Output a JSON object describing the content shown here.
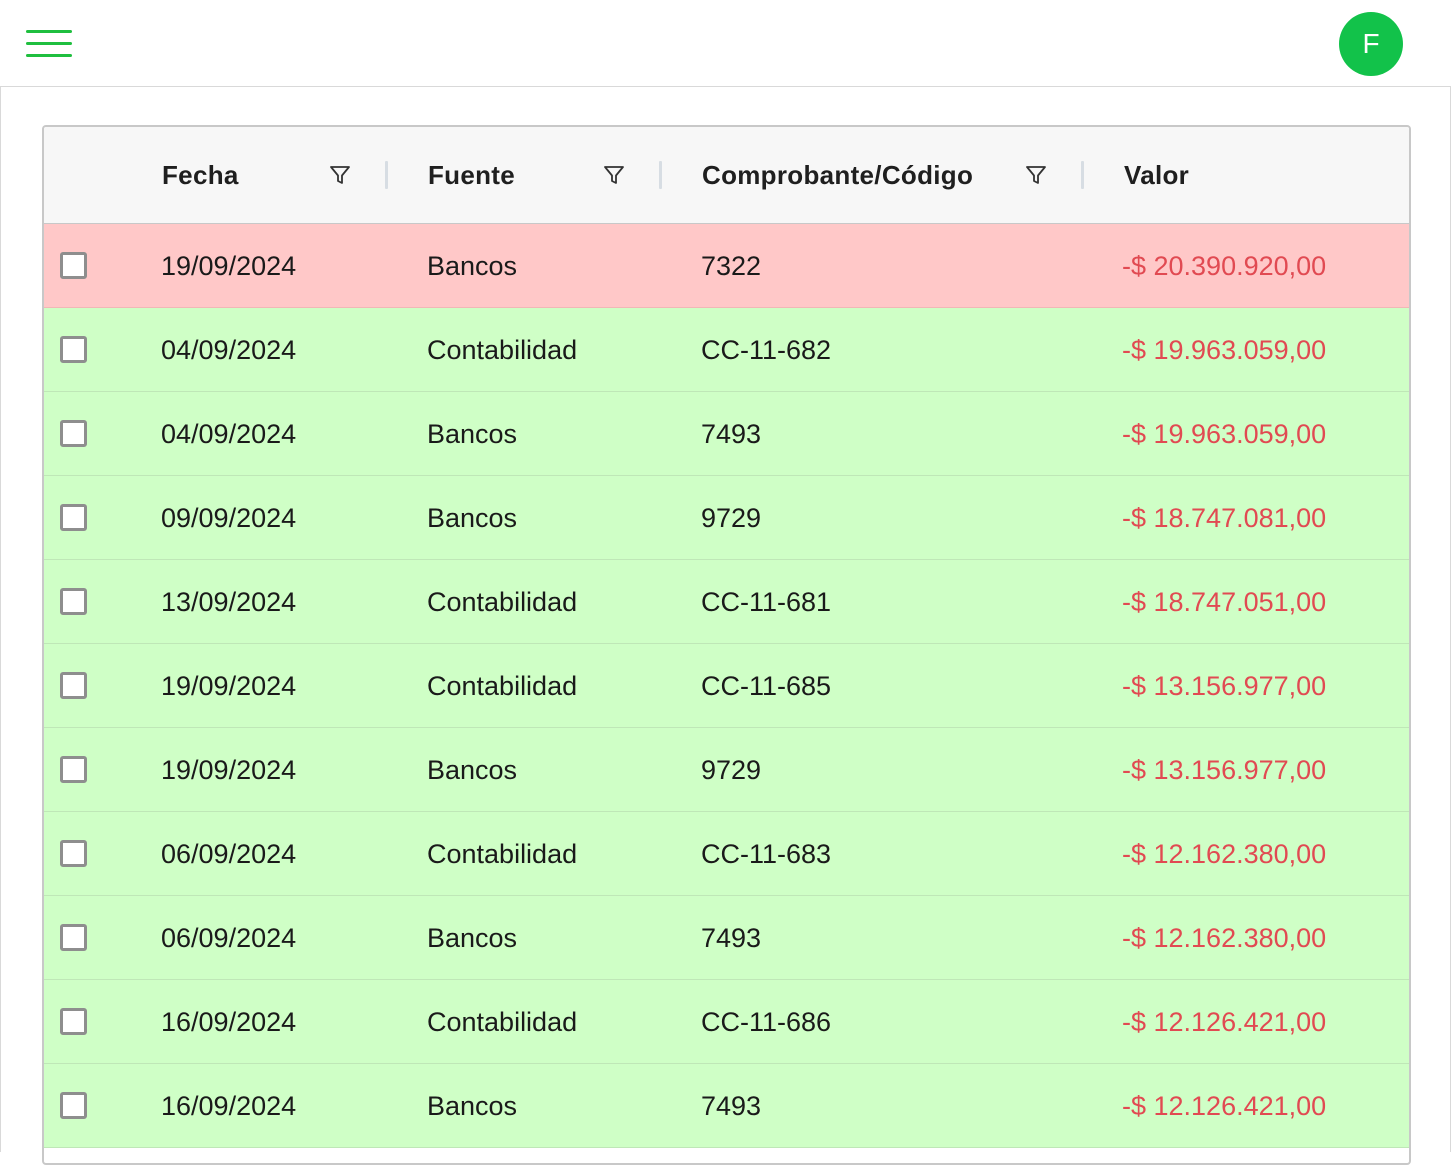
{
  "header": {
    "user_initial": "F"
  },
  "table": {
    "columns": [
      {
        "label": "Fecha",
        "filterable": true
      },
      {
        "label": "Fuente",
        "filterable": true
      },
      {
        "label": "Comprobante/Código",
        "filterable": true
      },
      {
        "label": "Valor",
        "filterable": false
      }
    ],
    "rows": [
      {
        "fecha": "19/09/2024",
        "fuente": "Bancos",
        "comprobante": "7322",
        "valor": "-$ 20.390.920,00",
        "status": "unmatched"
      },
      {
        "fecha": "04/09/2024",
        "fuente": "Contabilidad",
        "comprobante": "CC-11-682",
        "valor": "-$ 19.963.059,00",
        "status": "matched"
      },
      {
        "fecha": "04/09/2024",
        "fuente": "Bancos",
        "comprobante": "7493",
        "valor": "-$ 19.963.059,00",
        "status": "matched"
      },
      {
        "fecha": "09/09/2024",
        "fuente": "Bancos",
        "comprobante": "9729",
        "valor": "-$ 18.747.081,00",
        "status": "matched"
      },
      {
        "fecha": "13/09/2024",
        "fuente": "Contabilidad",
        "comprobante": "CC-11-681",
        "valor": "-$ 18.747.051,00",
        "status": "matched"
      },
      {
        "fecha": "19/09/2024",
        "fuente": "Contabilidad",
        "comprobante": "CC-11-685",
        "valor": "-$ 13.156.977,00",
        "status": "matched"
      },
      {
        "fecha": "19/09/2024",
        "fuente": "Bancos",
        "comprobante": "9729",
        "valor": "-$ 13.156.977,00",
        "status": "matched"
      },
      {
        "fecha": "06/09/2024",
        "fuente": "Contabilidad",
        "comprobante": "CC-11-683",
        "valor": "-$ 12.162.380,00",
        "status": "matched"
      },
      {
        "fecha": "06/09/2024",
        "fuente": "Bancos",
        "comprobante": "7493",
        "valor": "-$ 12.162.380,00",
        "status": "matched"
      },
      {
        "fecha": "16/09/2024",
        "fuente": "Contabilidad",
        "comprobante": "CC-11-686",
        "valor": "-$ 12.126.421,00",
        "status": "matched"
      },
      {
        "fecha": "16/09/2024",
        "fuente": "Bancos",
        "comprobante": "7493",
        "valor": "-$ 12.126.421,00",
        "status": "matched"
      }
    ]
  },
  "colors": {
    "accent": "#12c24a",
    "unmatched_row": "#ffc8c8",
    "matched_row": "#cfffc6",
    "negative_value": "#e14a52"
  },
  "icons": {
    "menu": "hamburger-menu-icon",
    "filter": "filter-funnel-icon"
  }
}
